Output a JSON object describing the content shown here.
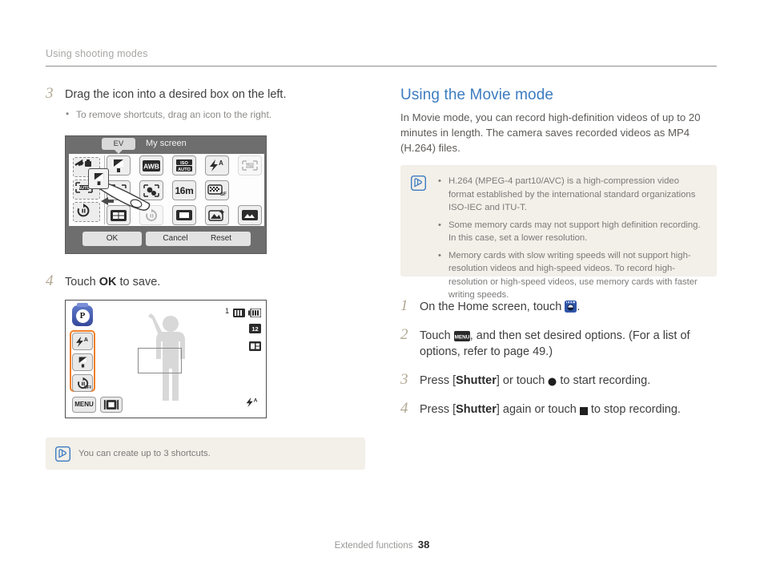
{
  "header": {
    "running_title": "Using shooting modes"
  },
  "left_column": {
    "step3": {
      "number": "3",
      "text": "Drag the icon into a desired box on the left.",
      "bullet": "To remove shortcuts, drag an icon to the right."
    },
    "step4": {
      "number": "4",
      "text_before": "Touch",
      "ok_label": "OK",
      "text_after": "to save."
    },
    "note": {
      "icon": "note-pencil-icon",
      "text": "You can create up to 3 shortcuts."
    }
  },
  "camera_my_screen": {
    "tab_tooltip": "EV",
    "title": "My screen",
    "slots": [
      {
        "name": "flash-shortcut-slot",
        "icon": "flash-icon"
      },
      {
        "name": "focus-auto-shortcut-slot",
        "icon": "af-auto-icon"
      },
      {
        "name": "timer-shortcut-slot",
        "icon": "timer-off-icon"
      }
    ],
    "grid_icons": [
      "ev-icon",
      "white-balance-auto-icon",
      "iso-auto-icon",
      "flash-auto-icon",
      "af-auto-icon-ghost",
      "face-detect-icon",
      "smart-af-icon",
      "resolution-16m-icon",
      "quality-sf-icon",
      "frame-guide-icon",
      "timer-off-icon-ghost",
      "display-icon",
      "photo-style-icon",
      "image-adjust-icon"
    ],
    "resolution_label": "16m",
    "quality_label": "SF",
    "iso_label": "ISO",
    "auto_label": "AUTO",
    "buttons": [
      {
        "name": "ok-button",
        "label": "OK"
      },
      {
        "name": "cancel-button",
        "label": "Cancel"
      },
      {
        "name": "reset-button",
        "label": "Reset"
      }
    ],
    "drag_tile_icon": "ev-icon"
  },
  "camera_live_view": {
    "mode_badge": "P",
    "shots_remaining": "1",
    "shortcuts": [
      {
        "name": "flash-auto-shortcut",
        "icon": "flash-auto-icon"
      },
      {
        "name": "ev-shortcut",
        "icon": "ev-icon"
      },
      {
        "name": "timer-off-shortcut",
        "icon": "timer-off-icon"
      }
    ],
    "menu_label": "MENU",
    "display_button_icon": "display-icon",
    "top_right_icons": [
      "memory-card-icon",
      "battery-icon",
      "resolution-12m-icon",
      "metering-icon"
    ],
    "bottom_right_icon": "flash-auto-icon"
  },
  "right_column": {
    "heading": "Using the Movie mode",
    "intro": "In Movie mode, you can record high-definition videos of up to 20 minutes in length. The camera saves recorded videos as MP4 (H.264) files.",
    "note": {
      "icon": "note-pencil-icon",
      "bullets": [
        "H.264 (MPEG-4 part10/AVC) is a high-compression video format established by the international standard organizations ISO-IEC and ITU-T.",
        "Some memory cards may not support high definition recording. In this case, set a lower resolution.",
        "Memory cards with slow writing speeds will not support high-resolution videos and high-speed videos. To record high-resolution or high-speed videos, use memory cards with faster writing speeds."
      ]
    },
    "steps": [
      {
        "number": "1",
        "before": "On the Home screen, touch",
        "icon": "movie-mode-icon",
        "after": "."
      },
      {
        "number": "2",
        "before": "Touch",
        "icon": "menu-icon",
        "after": ", and then set desired options. (For a list of options, refer to page 49.)"
      },
      {
        "number": "3",
        "before": "Press [",
        "bold": "Shutter",
        "mid": "] or touch",
        "icon": "record-dot-icon",
        "after": "to start recording."
      },
      {
        "number": "4",
        "before": "Press [",
        "bold": "Shutter",
        "mid": "] again or touch",
        "icon": "stop-square-icon",
        "after": "to stop recording."
      }
    ]
  },
  "footer": {
    "section": "Extended functions",
    "page": "38"
  },
  "colors": {
    "accent_blue": "#3c7cc0",
    "note_bg": "#f3efe9",
    "highlight_orange": "#f0802a",
    "step_number": "#b3a893"
  }
}
